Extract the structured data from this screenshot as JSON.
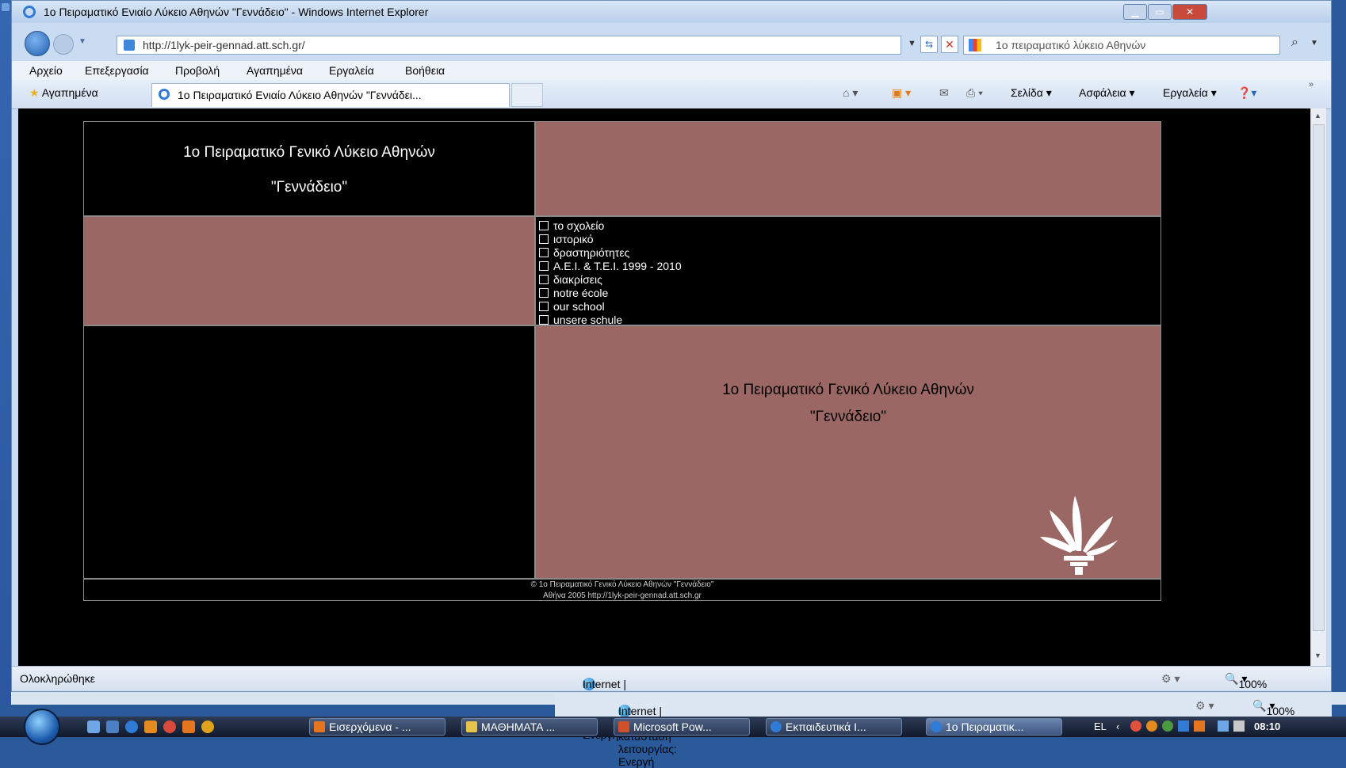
{
  "window": {
    "title": "1ο Πειραματικό Ενιαίο Λύκειο Αθηνών \"Γεννάδειο\" - Windows Internet Explorer",
    "address": "http://1lyk-peir-gennad.att.sch.gr/",
    "search_placeholder": "1ο πειραματικό λύκειο Αθηνών"
  },
  "menu": [
    "Αρχείο",
    "Επεξεργασία",
    "Προβολή",
    "Αγαπημένα",
    "Εργαλεία",
    "Βοήθεια"
  ],
  "favorites_label": "Αγαπημένα",
  "tab_label": "1ο Πειραματικό Ενιαίο Λύκειο Αθηνών \"Γεννάδει...",
  "command_bar": {
    "page": "Σελίδα ▾",
    "safety": "Ασφάλεια ▾",
    "tools": "Εργαλεία ▾"
  },
  "site": {
    "title_line1": "1ο Πειραματικό Γενικό Λύκειο Αθηνών",
    "title_line2": "\"Γεννάδειο\"",
    "nav": [
      "το σχολείο",
      "ιστορικό",
      "δραστηριότητες",
      "A.E.I. & T.E.I.  1999 - 2010",
      "διακρίσεις",
      "notre école",
      "our school",
      "unsere schule"
    ],
    "footer_line1": "© 1ο Πειραματικό Γενικό Λύκειο Αθηνών  \"Γεννάδειο\"",
    "footer_line2": "Αθήνα 2005   http://1lyk-peir-gennad.att.sch.gr"
  },
  "status": {
    "done": "Ολοκληρώθηκε",
    "zone": "Internet | Προστατευμένη κατάσταση λειτουργίας: Ενεργή",
    "zoom": "100%"
  },
  "taskbar": {
    "buttons": [
      "Εισερχόμενα - ...",
      "ΜΑΘΗΜΑΤΑ ...",
      "Microsoft Pow...",
      "Εκπαιδευτικά Ι...",
      "1ο Πειραματικ..."
    ],
    "lang": "EL",
    "time": "08:10"
  },
  "colors": {
    "rose": "#9a6764",
    "page_bg": "#000000",
    "chrome": "#c9dcf2"
  }
}
